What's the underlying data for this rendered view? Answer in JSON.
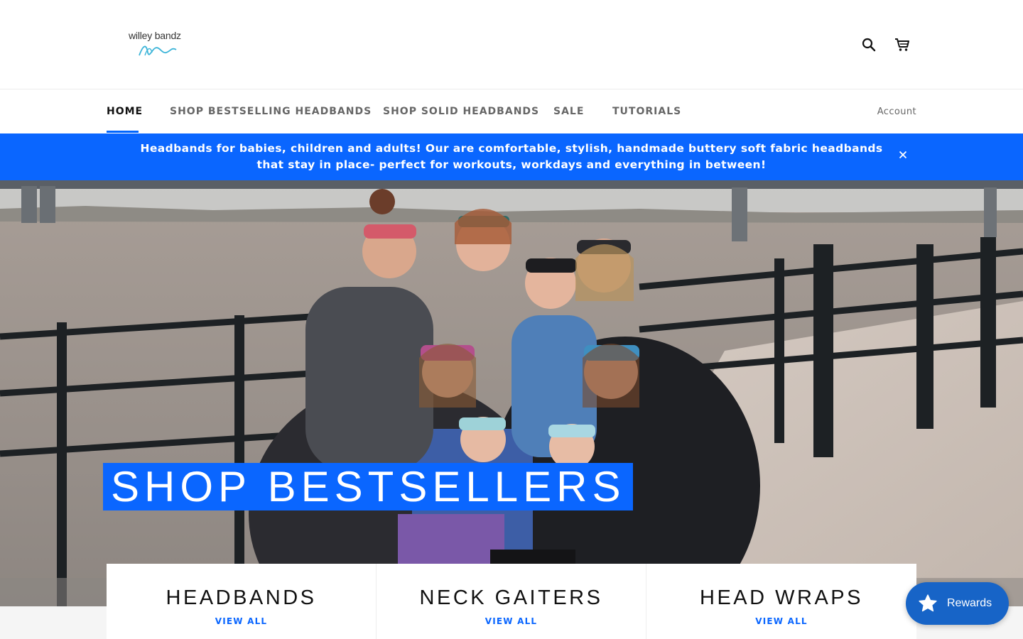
{
  "header": {
    "logo_text": "willey bandz",
    "search_icon": "search-icon",
    "cart_icon": "cart-icon"
  },
  "nav": {
    "items": [
      {
        "label": "HOME",
        "active": true
      },
      {
        "label": "SHOP BESTSELLING HEADBANDS",
        "active": false
      },
      {
        "label": "SHOP SOLID HEADBANDS",
        "active": false
      },
      {
        "label": "SALE",
        "active": false
      },
      {
        "label": "TUTORIALS",
        "active": false
      }
    ],
    "account_label": "Account"
  },
  "announcement": {
    "text": "Headbands for babies, children and adults! Our are comfortable, stylish, handmade buttery soft fabric headbands that stay in place- perfect for workouts, workdays and everything in between!",
    "close_icon": "close-icon"
  },
  "hero": {
    "title": "SHOP BESTSELLERS"
  },
  "collections": [
    {
      "title": "HEADBANDS",
      "link": "VIEW ALL"
    },
    {
      "title": "NECK GAITERS",
      "link": "VIEW ALL"
    },
    {
      "title": "HEAD WRAPS",
      "link": "VIEW ALL"
    }
  ],
  "rewards": {
    "label": "Rewards",
    "icon": "star-icon"
  },
  "colors": {
    "accent": "#0a66ff",
    "rewards_bg": "#1764c7"
  }
}
